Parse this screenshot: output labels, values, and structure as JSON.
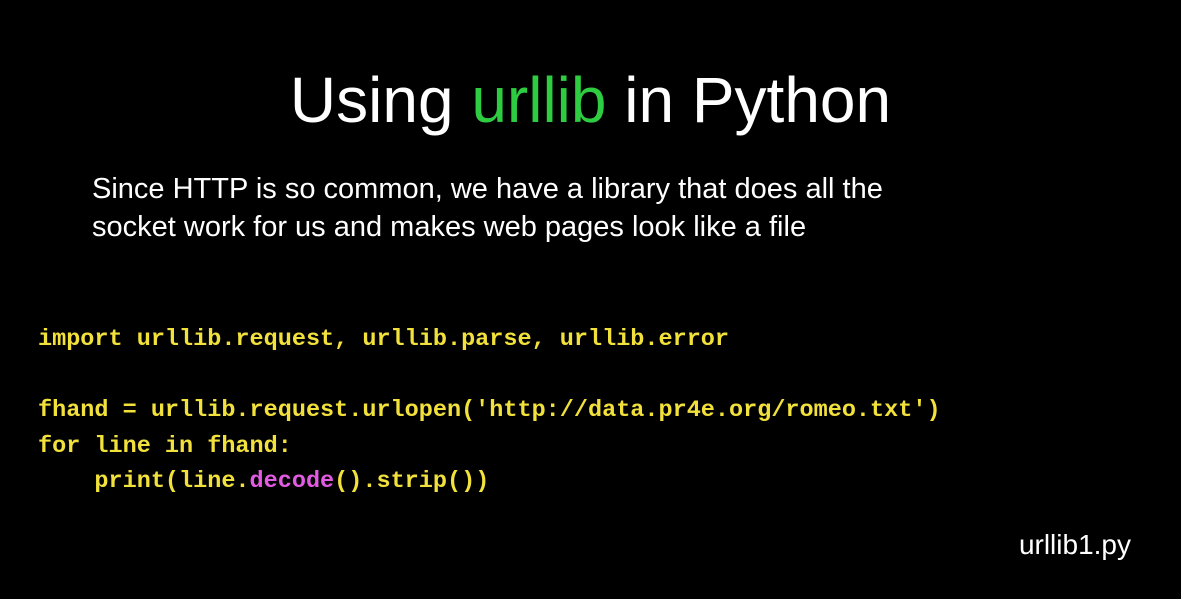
{
  "slide": {
    "title": {
      "prefix": "Using ",
      "highlight": "urllib",
      "suffix": " in Python"
    },
    "body_lines": [
      "Since HTTP is so common, we have a library that does all the",
      "socket work for us and makes web pages look like a file"
    ],
    "code": {
      "line1": "import urllib.request, urllib.parse, urllib.error",
      "line2": "",
      "line3": "fhand = urllib.request.urlopen('http://data.pr4e.org/romeo.txt')",
      "line4": "for line in fhand:",
      "line5_prefix": "    print(line.",
      "line5_highlight": "decode",
      "line5_suffix": "().strip())"
    },
    "filename": "urllib1.py"
  },
  "colors": {
    "background": "#000000",
    "text": "#ffffff",
    "accent_green": "#2ecc40",
    "code_yellow": "#f2e13b",
    "code_magenta": "#e45be3"
  }
}
